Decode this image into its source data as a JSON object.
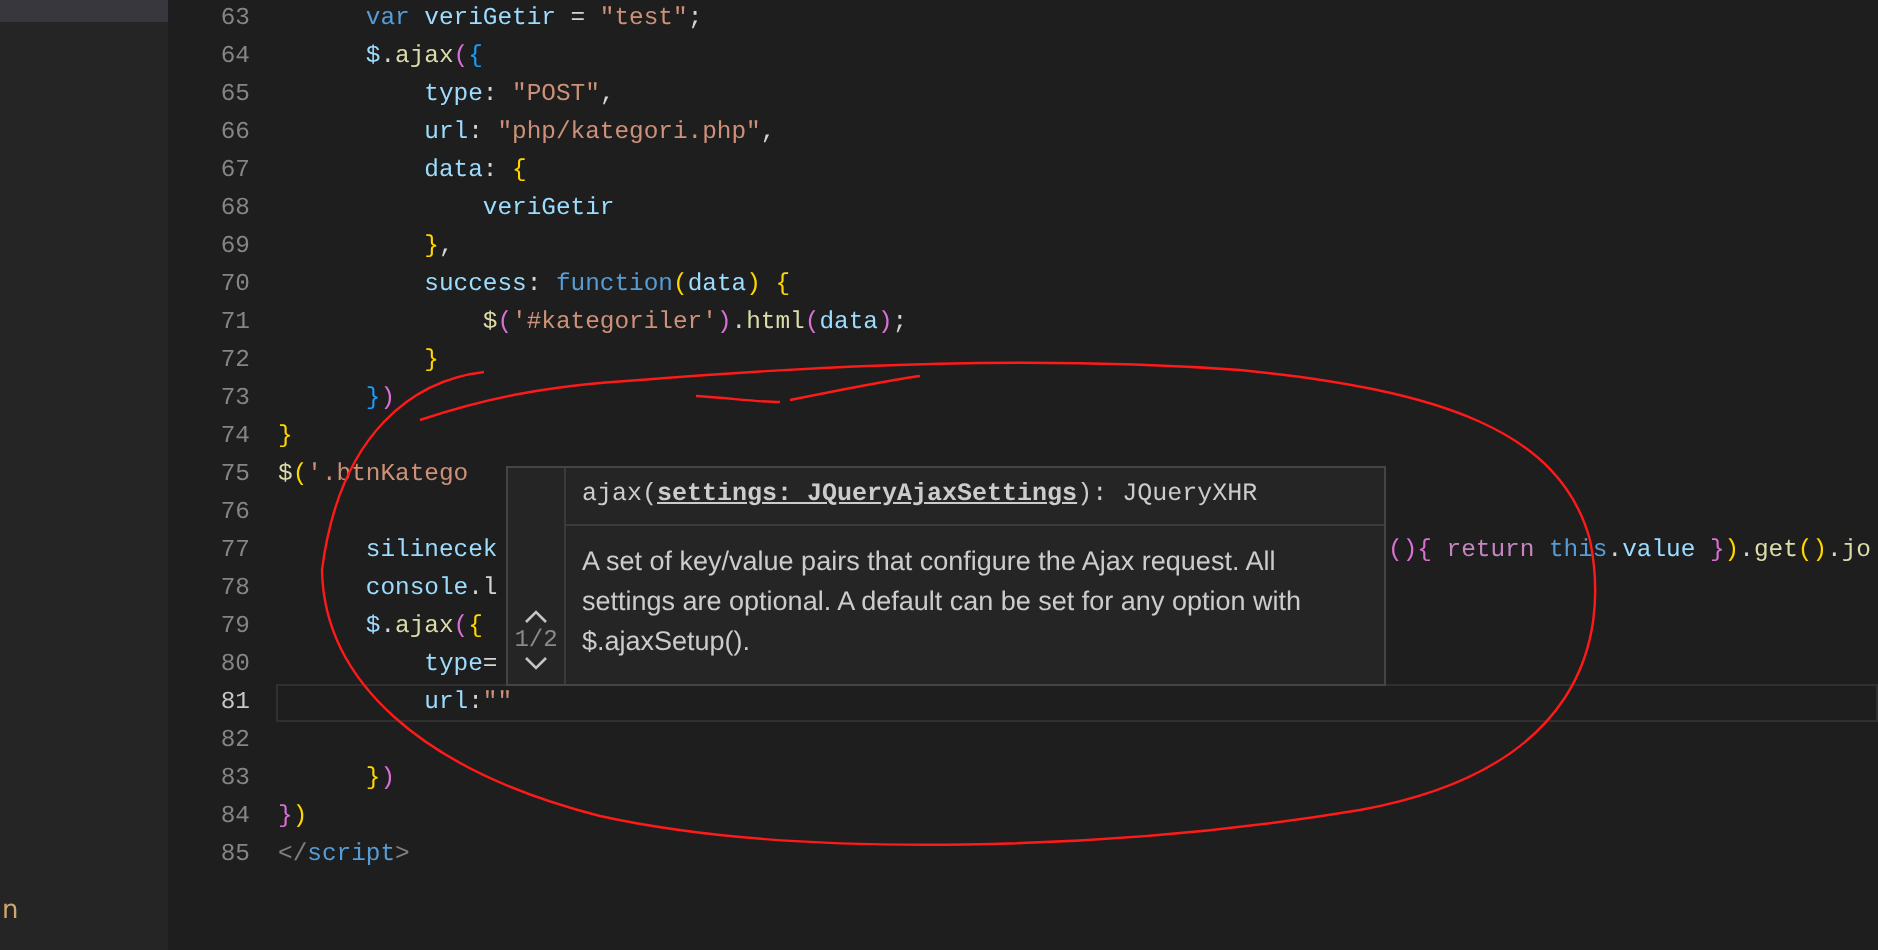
{
  "sidebar": {
    "items": [
      {
        "label": "n"
      }
    ]
  },
  "editor": {
    "lines": [
      {
        "number": "63",
        "current": false,
        "tokens": [
          {
            "text": "      var ",
            "kind": "kw"
          },
          {
            "text": "veriGetir",
            "kind": "var"
          },
          {
            "text": " = ",
            "kind": "p"
          },
          {
            "text": "\"test\"",
            "kind": "str"
          },
          {
            "text": ";",
            "kind": "p"
          }
        ]
      },
      {
        "number": "64",
        "current": false,
        "tokens": [
          {
            "text": "      $",
            "kind": "var"
          },
          {
            "text": ".",
            "kind": "p"
          },
          {
            "text": "ajax",
            "kind": "fn"
          },
          {
            "text": "(",
            "kind": "b2"
          },
          {
            "text": "{",
            "kind": "b3"
          }
        ]
      },
      {
        "number": "65",
        "current": false,
        "tokens": [
          {
            "text": "          type",
            "kind": "var"
          },
          {
            "text": ": ",
            "kind": "p"
          },
          {
            "text": "\"POST\"",
            "kind": "str"
          },
          {
            "text": ",",
            "kind": "p"
          }
        ]
      },
      {
        "number": "66",
        "current": false,
        "tokens": [
          {
            "text": "          url",
            "kind": "var"
          },
          {
            "text": ": ",
            "kind": "p"
          },
          {
            "text": "\"php/kategori.php\"",
            "kind": "str"
          },
          {
            "text": ",",
            "kind": "p"
          }
        ]
      },
      {
        "number": "67",
        "current": false,
        "tokens": [
          {
            "text": "          data",
            "kind": "var"
          },
          {
            "text": ": ",
            "kind": "p"
          },
          {
            "text": "{",
            "kind": "b1"
          }
        ]
      },
      {
        "number": "68",
        "current": false,
        "tokens": [
          {
            "text": "              veriGetir",
            "kind": "var"
          }
        ]
      },
      {
        "number": "69",
        "current": false,
        "tokens": [
          {
            "text": "          }",
            "kind": "b1"
          },
          {
            "text": ",",
            "kind": "p"
          }
        ]
      },
      {
        "number": "70",
        "current": false,
        "tokens": [
          {
            "text": "          success",
            "kind": "var"
          },
          {
            "text": ": ",
            "kind": "p"
          },
          {
            "text": "function",
            "kind": "kw"
          },
          {
            "text": "(",
            "kind": "b1"
          },
          {
            "text": "data",
            "kind": "var"
          },
          {
            "text": ")",
            "kind": "b1"
          },
          {
            "text": " {",
            "kind": "b1"
          }
        ]
      },
      {
        "number": "71",
        "current": false,
        "tokens": [
          {
            "text": "              $",
            "kind": "fn"
          },
          {
            "text": "(",
            "kind": "b2"
          },
          {
            "text": "'#kategoriler'",
            "kind": "str"
          },
          {
            "text": ")",
            "kind": "b2"
          },
          {
            "text": ".",
            "kind": "p"
          },
          {
            "text": "html",
            "kind": "fn"
          },
          {
            "text": "(",
            "kind": "b2"
          },
          {
            "text": "data",
            "kind": "var"
          },
          {
            "text": ")",
            "kind": "b2"
          },
          {
            "text": ";",
            "kind": "p"
          }
        ]
      },
      {
        "number": "72",
        "current": false,
        "tokens": [
          {
            "text": "          }",
            "kind": "b1"
          }
        ]
      },
      {
        "number": "73",
        "current": false,
        "tokens": [
          {
            "text": "      }",
            "kind": "b3"
          },
          {
            "text": ")",
            "kind": "b2"
          }
        ]
      },
      {
        "number": "74",
        "current": false,
        "tokens": [
          {
            "text": "}",
            "kind": "b1"
          }
        ]
      },
      {
        "number": "75",
        "current": false,
        "tokens": [
          {
            "text": "$",
            "kind": "fn"
          },
          {
            "text": "(",
            "kind": "b1"
          },
          {
            "text": "'.btnKatego",
            "kind": "str"
          }
        ]
      },
      {
        "number": "76",
        "current": false
      },
      {
        "number": "77",
        "current": false,
        "tokens": [
          {
            "text": "      silinecek",
            "kind": "var"
          }
        ],
        "tail": [
          {
            "text": "()",
            "kind": "b2"
          },
          {
            "text": "{ ",
            "kind": "b2"
          },
          {
            "text": "return ",
            "kind": "ctl"
          },
          {
            "text": "this",
            "kind": "kw"
          },
          {
            "text": ".",
            "kind": "p"
          },
          {
            "text": "value",
            "kind": "var"
          },
          {
            "text": " }",
            "kind": "b2"
          },
          {
            "text": ")",
            "kind": "b1"
          },
          {
            "text": ".",
            "kind": "p"
          },
          {
            "text": "get",
            "kind": "fn"
          },
          {
            "text": "()",
            "kind": "b1"
          },
          {
            "text": ".jo",
            "kind": "fn"
          }
        ]
      },
      {
        "number": "78",
        "current": false,
        "tokens": [
          {
            "text": "      console",
            "kind": "var"
          },
          {
            "text": ".l",
            "kind": "p"
          }
        ]
      },
      {
        "number": "79",
        "current": false,
        "tokens": [
          {
            "text": "      $",
            "kind": "var"
          },
          {
            "text": ".",
            "kind": "p"
          },
          {
            "text": "ajax",
            "kind": "fn"
          },
          {
            "text": "(",
            "kind": "b2"
          },
          {
            "text": "{",
            "kind": "b1"
          }
        ]
      },
      {
        "number": "80",
        "current": false,
        "tokens": [
          {
            "text": "          type",
            "kind": "var"
          },
          {
            "text": "=",
            "kind": "p"
          }
        ]
      },
      {
        "number": "81",
        "current": true,
        "tokens": [
          {
            "text": "          url",
            "kind": "var"
          },
          {
            "text": ":",
            "kind": "p"
          },
          {
            "text": "\"\"",
            "kind": "str"
          }
        ]
      },
      {
        "number": "82",
        "current": false
      },
      {
        "number": "83",
        "current": false,
        "tokens": [
          {
            "text": "      }",
            "kind": "b1"
          },
          {
            "text": ")",
            "kind": "b2"
          }
        ]
      },
      {
        "number": "84",
        "current": false,
        "tokens": [
          {
            "text": "}",
            "kind": "b2"
          },
          {
            "text": ")",
            "kind": "b1"
          }
        ]
      },
      {
        "number": "85",
        "current": false,
        "tokens": [
          {
            "text": "</",
            "kind": "tag"
          },
          {
            "text": "script",
            "kind": "kw"
          },
          {
            "text": ">",
            "kind": "tag"
          }
        ]
      }
    ]
  },
  "hover": {
    "counter": "1/2",
    "signature": {
      "before": "ajax(",
      "param": "settings: JQueryAjaxSettings",
      "after": "): JQueryXHR"
    },
    "description": "A set of key/value pairs that configure the Ajax request. All settings are optional. A default can be set for any option with $.ajaxSetup()."
  }
}
